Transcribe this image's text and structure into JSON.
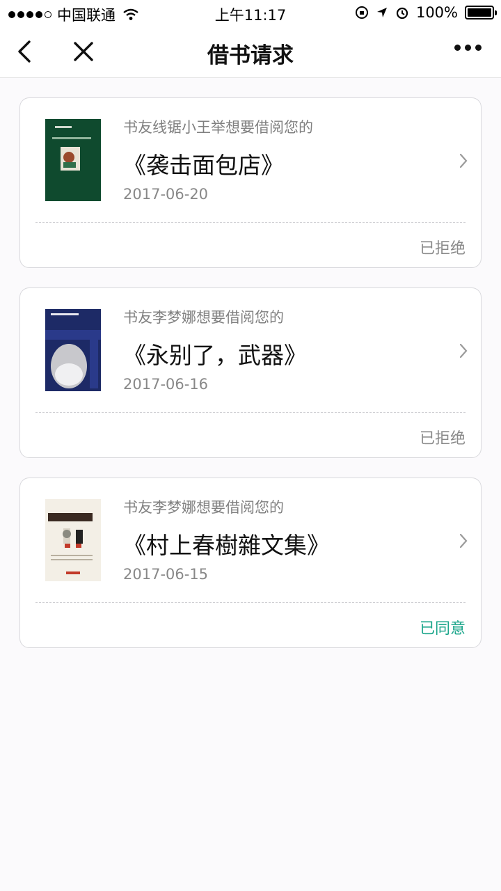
{
  "status_bar": {
    "carrier": "中国联通",
    "time": "上午11:17",
    "battery": "100%"
  },
  "nav": {
    "title": "借书请求",
    "icons": [
      "back-arrow-icon",
      "close-icon",
      "more-dots-icon"
    ]
  },
  "requests": [
    {
      "requester": "书友线锯小王举想要借阅您的",
      "book": "《袭击面包店》",
      "date": "2017-06-20",
      "status": "已拒绝",
      "cover_color": "#0f4a2e"
    },
    {
      "requester": "书友李梦娜想要借阅您的",
      "book": "《永别了，武器》",
      "date": "2017-06-16",
      "status": "已拒绝",
      "cover_color": "#1d2a66"
    },
    {
      "requester": "书友李梦娜想要借阅您的",
      "book": "《村上春樹雜文集》",
      "date": "2017-06-15",
      "status": "已同意",
      "cover_color": "#f3efe6"
    }
  ],
  "colors": {
    "agreed": "#1aa58a",
    "rejected": "#8a8a8a"
  }
}
